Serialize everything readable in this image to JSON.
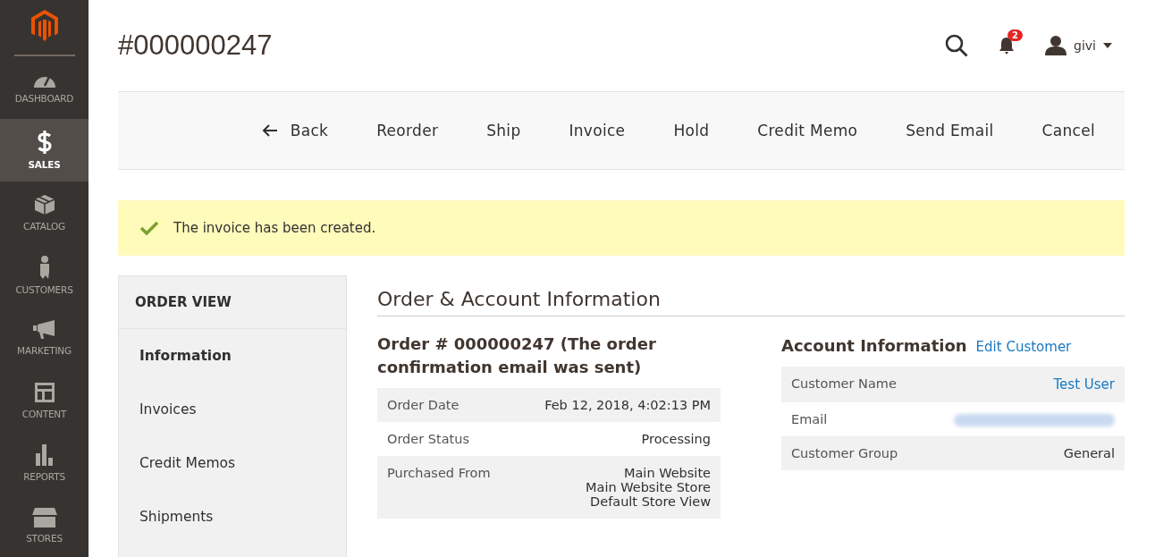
{
  "sidebar": {
    "items": [
      {
        "label": "DASHBOARD",
        "selected": false
      },
      {
        "label": "SALES",
        "selected": true
      },
      {
        "label": "CATALOG",
        "selected": false
      },
      {
        "label": "CUSTOMERS",
        "selected": false
      },
      {
        "label": "MARKETING",
        "selected": false
      },
      {
        "label": "CONTENT",
        "selected": false
      },
      {
        "label": "REPORTS",
        "selected": false
      },
      {
        "label": "STORES",
        "selected": false
      }
    ]
  },
  "header": {
    "title": "#000000247",
    "notifications": "2",
    "user": "givi"
  },
  "actions": [
    {
      "label": "Back",
      "kind": "back"
    },
    {
      "label": "Reorder",
      "kind": "plain"
    },
    {
      "label": "Ship",
      "kind": "plain"
    },
    {
      "label": "Invoice",
      "kind": "plain"
    },
    {
      "label": "Hold",
      "kind": "plain"
    },
    {
      "label": "Credit Memo",
      "kind": "plain"
    },
    {
      "label": "Send Email",
      "kind": "plain"
    },
    {
      "label": "Cancel",
      "kind": "plain"
    }
  ],
  "message": {
    "text": "The invoice has been created."
  },
  "order_view": {
    "title": "ORDER VIEW",
    "tabs": [
      {
        "label": "Information",
        "selected": true
      },
      {
        "label": "Invoices",
        "selected": false
      },
      {
        "label": "Credit Memos",
        "selected": false
      },
      {
        "label": "Shipments",
        "selected": false
      }
    ]
  },
  "section_title": "Order & Account Information",
  "order": {
    "title": "Order # 000000247 (The order confirmation email was sent)",
    "rows": [
      {
        "label": "Order Date",
        "values": [
          "Feb 12, 2018, 4:02:13 PM"
        ]
      },
      {
        "label": "Order Status",
        "values": [
          "Processing"
        ]
      },
      {
        "label": "Purchased From",
        "values": [
          "Main Website",
          "Main Website Store",
          "Default Store View"
        ]
      }
    ]
  },
  "account": {
    "title": "Account Information",
    "edit_link": "Edit Customer",
    "rows": [
      {
        "label": "Customer Name",
        "value": "Test User",
        "kind": "link"
      },
      {
        "label": "Email",
        "kind": "redacted"
      },
      {
        "label": "Customer Group",
        "value": "General",
        "kind": "text"
      }
    ]
  }
}
